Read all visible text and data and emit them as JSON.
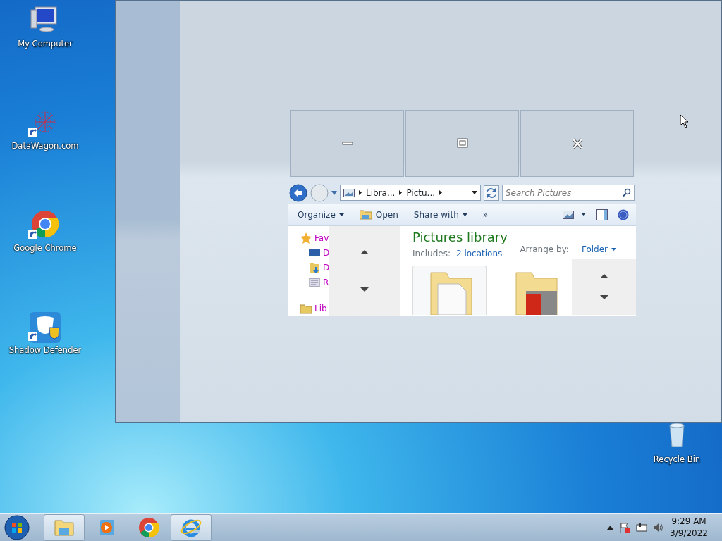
{
  "desktop_icons": [
    {
      "label": "My Computer",
      "kind": "computer",
      "shortcut": false
    },
    {
      "label": "DataWagon.com",
      "kind": "web",
      "shortcut": true
    },
    {
      "label": "Google Chrome",
      "kind": "chrome",
      "shortcut": true
    },
    {
      "label": "Shadow Defender",
      "kind": "shield",
      "shortcut": true
    },
    {
      "label": "Recycle Bin",
      "kind": "recycle",
      "shortcut": false
    }
  ],
  "window": {
    "caption_buttons": [
      {
        "kind": "minimize"
      },
      {
        "kind": "maximize"
      },
      {
        "kind": "close"
      }
    ],
    "explorer": {
      "breadcrumb": [
        "Libra...",
        "Pictu..."
      ],
      "search": {
        "placeholder": "Search Pictures"
      },
      "toolbar": [
        {
          "label": "Organize",
          "kind": "menu"
        },
        {
          "label": "Open",
          "kind": "open"
        },
        {
          "label": "Share with",
          "kind": "menu"
        },
        {
          "label": "»",
          "kind": "more"
        }
      ],
      "nav_items": [
        {
          "label": "Fav",
          "kind": "favorites"
        },
        {
          "label": "D",
          "kind": "desktop"
        },
        {
          "label": "D",
          "kind": "downloads"
        },
        {
          "label": "R",
          "kind": "recent"
        },
        {
          "label": "Lib",
          "kind": "libraries"
        }
      ],
      "title": "Pictures library",
      "includes_label": "Includes:",
      "includes_link": "2 locations",
      "arrange_label": "Arrange by:",
      "arrange_value": "Folder",
      "folders": [
        {
          "kind": "documents"
        },
        {
          "kind": "pictures"
        }
      ]
    }
  },
  "taskbar": {
    "items": [
      {
        "kind": "explorer",
        "open": true
      },
      {
        "kind": "media",
        "open": false
      },
      {
        "kind": "chrome",
        "open": false
      },
      {
        "kind": "ie",
        "open": true
      }
    ],
    "time": "9:29 AM",
    "date": "3/9/2022"
  }
}
